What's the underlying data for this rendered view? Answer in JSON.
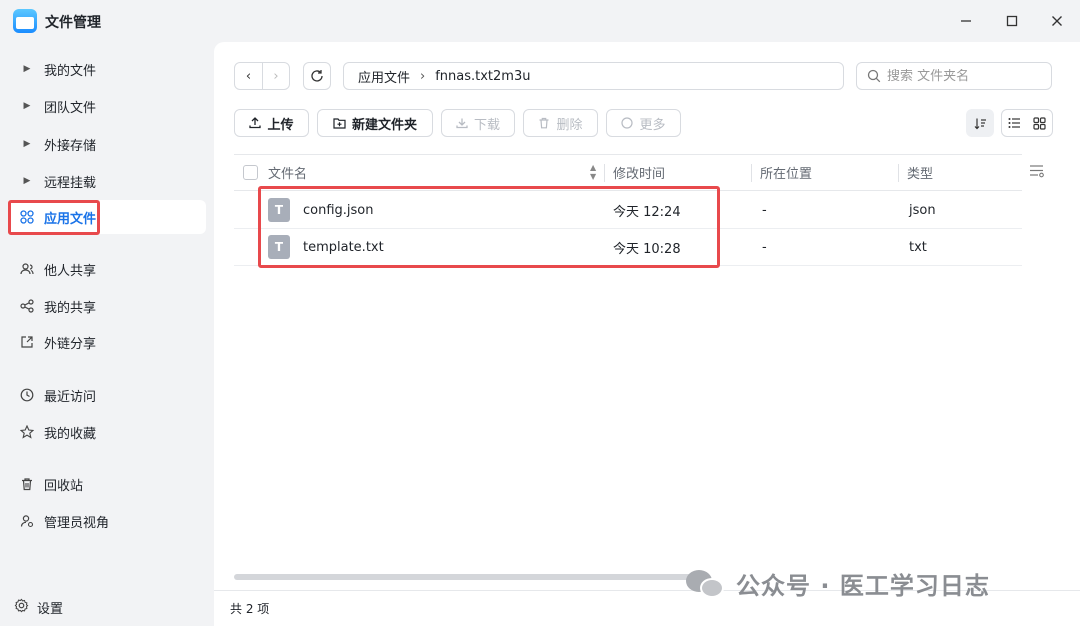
{
  "window": {
    "title": "文件管理",
    "minimize_icon": "minimize-icon",
    "maximize_icon": "maximize-icon",
    "close_icon": "close-icon"
  },
  "sidebar": {
    "items": [
      {
        "label": "我的文件",
        "icon": "caret-right-icon"
      },
      {
        "label": "团队文件",
        "icon": "caret-right-icon"
      },
      {
        "label": "外接存储",
        "icon": "caret-right-icon"
      },
      {
        "label": "远程挂载",
        "icon": "caret-right-icon"
      },
      {
        "label": "应用文件",
        "icon": "apps-grid-icon",
        "active": true
      },
      {
        "label": "他人共享",
        "icon": "users-icon"
      },
      {
        "label": "我的共享",
        "icon": "share-icon"
      },
      {
        "label": "外链分享",
        "icon": "external-link-icon"
      },
      {
        "label": "最近访问",
        "icon": "clock-icon"
      },
      {
        "label": "我的收藏",
        "icon": "star-icon"
      },
      {
        "label": "回收站",
        "icon": "trash-icon"
      },
      {
        "label": "管理员视角",
        "icon": "admin-user-icon"
      }
    ],
    "settings_label": "设置"
  },
  "path": {
    "root": "应用文件",
    "current": "fnnas.txt2m3u"
  },
  "search": {
    "placeholder": "搜索 文件夹名"
  },
  "toolbar": {
    "upload": "上传",
    "new_folder": "新建文件夹",
    "download": "下载",
    "delete": "删除",
    "more": "更多"
  },
  "table": {
    "headers": {
      "name": "文件名",
      "modified": "修改时间",
      "location": "所在位置",
      "type": "类型"
    },
    "rows": [
      {
        "name": "config.json",
        "modified": "今天 12:24",
        "location": "-",
        "type": "json",
        "icon_letter": "T"
      },
      {
        "name": "template.txt",
        "modified": "今天 10:28",
        "location": "-",
        "type": "txt",
        "icon_letter": "T"
      }
    ]
  },
  "footer": {
    "count": "共 2 项"
  },
  "watermark": {
    "text": "公众号 · 医工学习日志"
  },
  "colors": {
    "accent": "#1a73e8",
    "highlight": "#e8494c"
  }
}
